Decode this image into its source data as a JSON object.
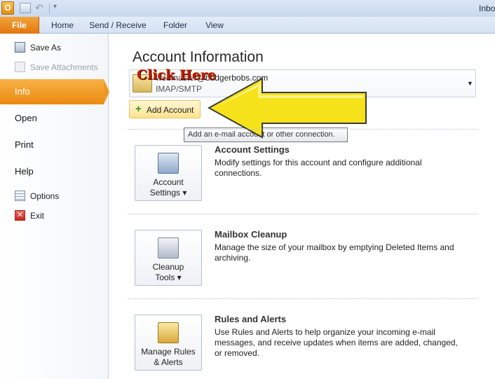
{
  "window": {
    "title": "Inbo",
    "app_icon": "O"
  },
  "ribbon": {
    "tabs": [
      "File",
      "Home",
      "Send / Receive",
      "Folder",
      "View"
    ]
  },
  "nav": {
    "save_as": "Save As",
    "save_attachments": "Save Attachments",
    "info": "Info",
    "open": "Open",
    "print": "Print",
    "help": "Help",
    "options": "Options",
    "exit": "Exit",
    "exit_glyph": "✕"
  },
  "main": {
    "heading": "Account Information",
    "account": {
      "email": "webmaster@badgerbobs.com",
      "type": "IMAP/SMTP",
      "arrow": "▼"
    },
    "add_account": {
      "icon": "+",
      "label": "Add Account"
    },
    "tooltip": "Add an e-mail account or other connection.",
    "callout": "Click Here",
    "sections": [
      {
        "button_line1": "Account",
        "button_line2": "Settings ▾",
        "title": "Account Settings",
        "desc": "Modify settings for this account and configure additional connections."
      },
      {
        "button_line1": "Cleanup",
        "button_line2": "Tools ▾",
        "title": "Mailbox Cleanup",
        "desc": "Manage the size of your mailbox by emptying Deleted Items and archiving."
      },
      {
        "button_line1": "Manage Rules",
        "button_line2": "& Alerts",
        "title": "Rules and Alerts",
        "desc": "Use Rules and Alerts to help organize your incoming e-mail messages, and receive updates when items are added, changed, or removed."
      }
    ]
  },
  "colors": {
    "accent": "#ec8a12",
    "callout_arrow": "#f5e21a",
    "callout_text": "#c41414"
  }
}
